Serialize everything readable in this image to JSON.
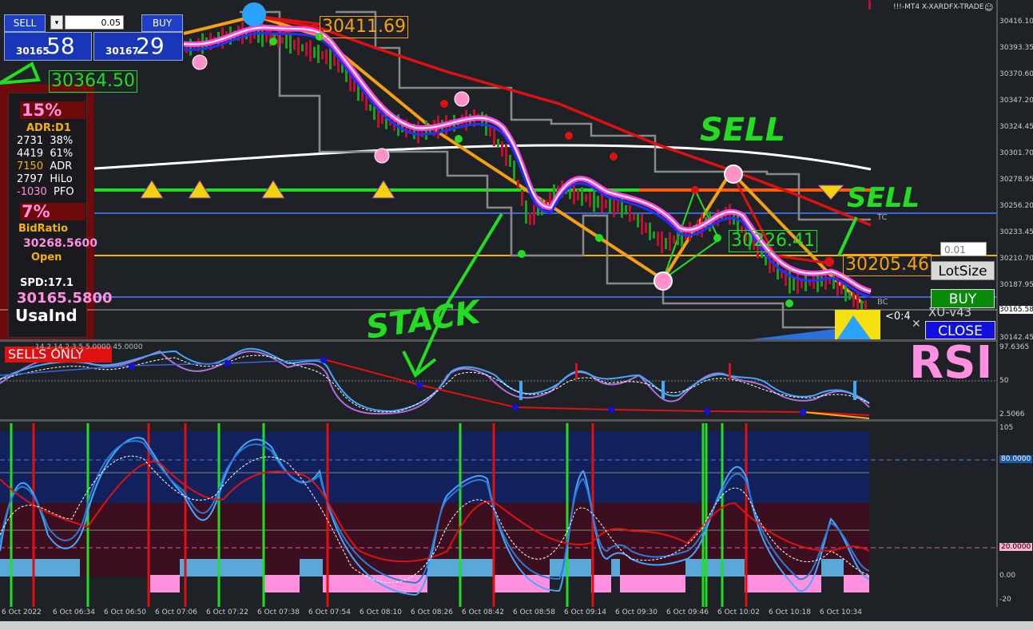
{
  "window": {
    "title": "!!!-MT4 X-XARDFX-TRADE"
  },
  "trade_panel": {
    "sell_label": "SELL",
    "buy_label": "BUY",
    "lot_value": "0.05",
    "sell_price_small": "30165",
    "sell_price_big": "58",
    "buy_price_small": "30167",
    "buy_price_big": "29"
  },
  "info_panel": {
    "adr_pct": "15%",
    "adr_label": "ADR:D1",
    "rows": [
      {
        "a": "2731",
        "b": "38%"
      },
      {
        "a": "4419",
        "b": "61%"
      },
      {
        "a": "7150",
        "b": "ADR"
      },
      {
        "a": "2797",
        "b": "HiLo"
      },
      {
        "a": "-1030",
        "b": "PFO"
      }
    ],
    "bid_pct": "7%",
    "bid_label": "BidRatio",
    "open_price": "30268.5600",
    "open_label": "Open",
    "spd": "SPD:17.1",
    "current_price": "30165.5800",
    "symbol": "UsaInd"
  },
  "price_tags": {
    "high": "30411.69",
    "left": "30364.50",
    "mid": "30226.41",
    "right": "30205.46"
  },
  "right_panel": {
    "lot_input": "0.01",
    "lotsize_label": "LotSize",
    "buy_label": "BUY",
    "close_label": "CLOSE",
    "version": "XU-v43",
    "timer": "<0:4"
  },
  "chart_labels": {
    "tc": "TC",
    "bc": "BC",
    "sells_only": "SELLS ONLY",
    "rsi_big": "RSI",
    "rsi_header": "14.2 14.2 3 5 5.0000 45.0000"
  },
  "annotations": {
    "sell1": "SELL",
    "sell2": "SELL",
    "stack": "STACK"
  },
  "price_axis": [
    "30416.10",
    "30393.35",
    "30370.60",
    "30347.20",
    "30324.45",
    "30301.70",
    "30278.95",
    "30256.20",
    "30233.45",
    "30210.70",
    "30187.95",
    "30165.58",
    "30142.45"
  ],
  "rsi_axis": {
    "top": "97.6365",
    "mid": "50",
    "bottom": "2.5066"
  },
  "stoch_axis": {
    "top": "105",
    "l80": "80.0000",
    "l20": "20.0000",
    "zero": "0.00",
    "bottom": "-20"
  },
  "time_axis": [
    "6 Oct 2022",
    "6 Oct 06:34",
    "6 Oct 06:50",
    "6 Oct 07:06",
    "6 Oct 07:22",
    "6 Oct 07:38",
    "6 Oct 07:54",
    "6 Oct 08:10",
    "6 Oct 08:26",
    "6 Oct 08:42",
    "6 Oct 08:58",
    "6 Oct 09:14",
    "6 Oct 09:30",
    "6 Oct 09:46",
    "6 Oct 10:02",
    "6 Oct 10:18",
    "6 Oct 10:34"
  ],
  "colors": {
    "bg": "#1e2126",
    "sell": "#1f3fc8",
    "buy_green": "#0a8a0a",
    "close": "#1010e0",
    "pink": "#ff8fe0",
    "orange": "#f5b20a",
    "red": "#e01010",
    "green": "#22dd22"
  }
}
